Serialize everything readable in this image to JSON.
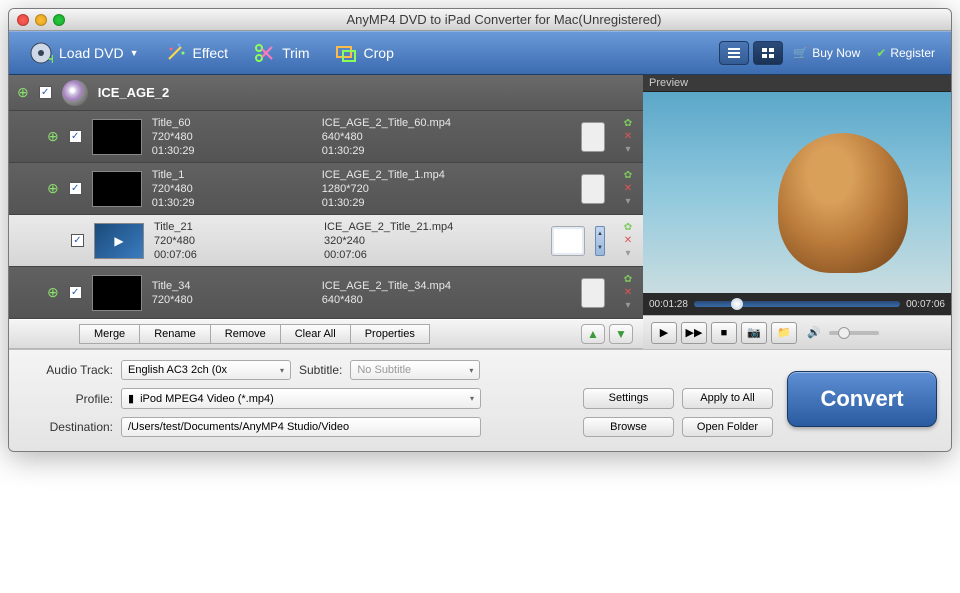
{
  "window": {
    "title": "AnyMP4 DVD to iPad Converter for Mac(Unregistered)"
  },
  "toolbar": {
    "load": "Load DVD",
    "effect": "Effect",
    "trim": "Trim",
    "crop": "Crop",
    "buy": "Buy Now",
    "register": "Register"
  },
  "disc": {
    "title": "ICE_AGE_2"
  },
  "titles": [
    {
      "name": "Title_60",
      "res": "720*480",
      "dur": "01:30:29",
      "out": "ICE_AGE_2_Title_60.mp4",
      "ores": "640*480",
      "odur": "01:30:29",
      "selected": false,
      "thumb": "black"
    },
    {
      "name": "Title_1",
      "res": "720*480",
      "dur": "01:30:29",
      "out": "ICE_AGE_2_Title_1.mp4",
      "ores": "1280*720",
      "odur": "01:30:29",
      "selected": false,
      "thumb": "black"
    },
    {
      "name": "Title_21",
      "res": "720*480",
      "dur": "00:07:06",
      "out": "ICE_AGE_2_Title_21.mp4",
      "ores": "320*240",
      "odur": "00:07:06",
      "selected": true,
      "thumb": "play"
    },
    {
      "name": "Title_34",
      "res": "720*480",
      "dur": "",
      "out": "ICE_AGE_2_Title_34.mp4",
      "ores": "640*480",
      "odur": "",
      "selected": false,
      "thumb": "img"
    }
  ],
  "midbar": {
    "merge": "Merge",
    "rename": "Rename",
    "remove": "Remove",
    "clear": "Clear All",
    "props": "Properties"
  },
  "preview": {
    "label": "Preview",
    "cur": "00:01:28",
    "total": "00:07:06"
  },
  "settings": {
    "audio_label": "Audio Track:",
    "audio_val": "English AC3 2ch (0x",
    "sub_label": "Subtitle:",
    "sub_val": "No Subtitle",
    "profile_label": "Profile:",
    "profile_val": "iPod MPEG4 Video (*.mp4)",
    "dest_label": "Destination:",
    "dest_val": "/Users/test/Documents/AnyMP4 Studio/Video",
    "settings_btn": "Settings",
    "apply_btn": "Apply to All",
    "browse_btn": "Browse",
    "open_btn": "Open Folder"
  },
  "convert": "Convert"
}
